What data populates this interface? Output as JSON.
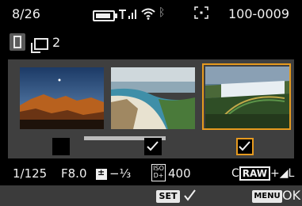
{
  "topbar": {
    "image_index": "8/26",
    "battery_level": 0.9,
    "file_number": "100-0009"
  },
  "selection": {
    "count": "2"
  },
  "thumbnails": [
    {
      "checked": false
    },
    {
      "checked": true
    },
    {
      "checked": true,
      "selected": true
    }
  ],
  "exposure": {
    "shutter": "1/125",
    "aperture": "F8.0",
    "exp_comp": "−⅓",
    "iso_label": "ISO D+",
    "iso": "400",
    "quality_prefix": "C",
    "raw": "RAW",
    "quality_suffix": "+◢L"
  },
  "buttons": {
    "set": "SET",
    "menu": "MENU",
    "ok": "OK"
  },
  "colors": {
    "accent": "#e69a1f",
    "panel": "#3f3f3f"
  }
}
